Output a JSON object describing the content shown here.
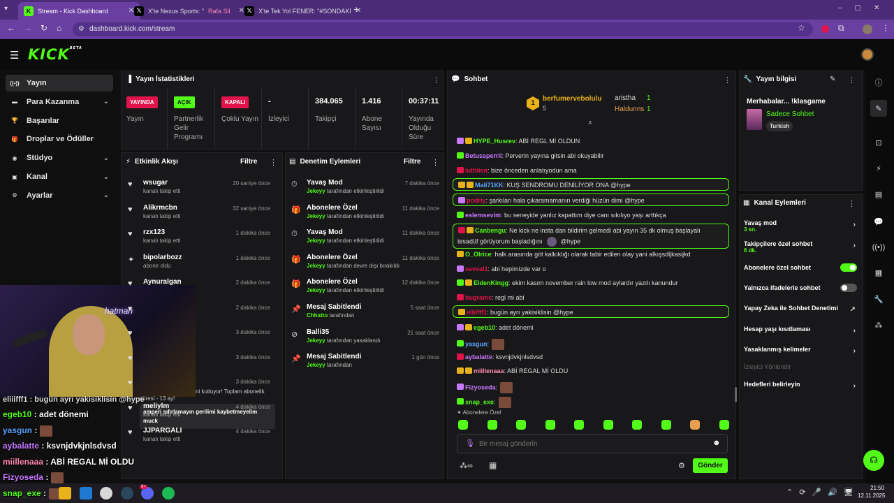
{
  "browser": {
    "tabs": [
      {
        "label": "Stream - Kick Dashboard",
        "icon": "kick-icon"
      },
      {
        "label": "X'te Nexus Sports: \"",
        "extra": "Rafa Sil",
        "icon": "x-icon"
      },
      {
        "label": "X'te Tek Yol FENER: \"#SONDAKİ",
        "icon": "x-icon"
      }
    ],
    "url": "dashboard.kick.com/stream"
  },
  "header": {
    "logo": "KICK",
    "logo_sup": "BETA"
  },
  "sidebar": {
    "items": [
      {
        "label": "Yayın",
        "icon": "broadcast-icon",
        "chevron": false,
        "active": true
      },
      {
        "label": "Para Kazanma",
        "icon": "money-icon",
        "chevron": true
      },
      {
        "label": "Başarılar",
        "icon": "trophy-icon",
        "chevron": false
      },
      {
        "label": "Droplar ve Ödüller",
        "icon": "gift-icon",
        "chevron": false
      },
      {
        "label": "Stüdyo",
        "icon": "studio-icon",
        "chevron": true
      },
      {
        "label": "Kanal",
        "icon": "channel-icon",
        "chevron": true
      },
      {
        "label": "Ayarlar",
        "icon": "gear-icon",
        "chevron": true
      }
    ]
  },
  "stats": {
    "title": "Yayın İstatistikleri",
    "items": [
      {
        "badge": "YAYINDA",
        "badge_color": "#e0134a",
        "label": "Yayın"
      },
      {
        "badge": "AÇIK",
        "badge_color": "#53fc18",
        "label": "Partnerlik Gelir Programı"
      },
      {
        "badge": "KAPALI",
        "badge_color": "#e0134a",
        "label": "Çoklu Yayın"
      },
      {
        "value": "-",
        "label": "İzleyici"
      },
      {
        "value": "384.065",
        "label": "Takipçi"
      },
      {
        "value": "1.416",
        "label": "Abone Sayısı"
      },
      {
        "value": "00:37:11",
        "label": "Yayında Olduğu Süre"
      }
    ]
  },
  "activity": {
    "title": "Etkinlik Akışı",
    "filter": "Filtre",
    "items": [
      {
        "name": "wsugar",
        "sub": "kanalı takip etti",
        "time": "20 saniye önce",
        "icon": "heart-icon"
      },
      {
        "name": "Alikrmcbn",
        "sub": "kanalı takip etti",
        "time": "32 saniye önce",
        "icon": "heart-icon"
      },
      {
        "name": "rzx123",
        "sub": "kanalı takip etti",
        "time": "1 dakika önce",
        "icon": "heart-icon"
      },
      {
        "name": "bipolarbozz",
        "sub": "abone oldu",
        "time": "1 dakika önce",
        "icon": "star-icon"
      },
      {
        "name": "Aynuralgan",
        "sub": "",
        "time": "2 dakika önce",
        "icon": "heart-icon"
      },
      {
        "name": "",
        "sub": "",
        "time": "2 dakika önce",
        "icon": "heart-icon"
      },
      {
        "name": "",
        "sub": "",
        "time": "3 dakika önce",
        "icon": "heart-icon"
      },
      {
        "name": "",
        "sub": "",
        "time": "3 dakika önce",
        "icon": "heart-icon"
      },
      {
        "name": "",
        "sub": "",
        "time": "3 dakika önce",
        "icon": "heart-icon"
      },
      {
        "name": "meliylm",
        "sub": "kanalı takip etti",
        "time": "4 dakika önce",
        "icon": "heart-icon"
      },
      {
        "name": "JJPARGALI",
        "sub": "kanalı takip etti",
        "time": "4 dakika önce",
        "icon": "heart-icon"
      }
    ],
    "sub_note_1": "ni kutluyor! Toplam abonelik",
    "sub_note_2": "süresi - 13 ay!",
    "sub_note_msg": "amperi sıfırlamayın gerilimi kaybetmeyelim muck"
  },
  "moderation": {
    "title": "Denetim Eylemleri",
    "filter": "Filtre",
    "items": [
      {
        "title": "Yavaş Mod",
        "actor": "Jekeyy",
        "action": "tarafından etkinleştirildi",
        "time": "7 dakika önce",
        "icon": "slow-mode-icon"
      },
      {
        "title": "Abonelere Özel",
        "actor": "Jekeyy",
        "action": "tarafından etkinleştirildi",
        "time": "11 dakika önce",
        "icon": "gift-icon"
      },
      {
        "title": "Yavaş Mod",
        "actor": "Jekeyy",
        "action": "tarafından etkinleştirildi",
        "time": "11 dakika önce",
        "icon": "slow-mode-icon"
      },
      {
        "title": "Abonelere Özel",
        "actor": "Jekeyy",
        "action": "tarafından devre dışı bırakıldı",
        "time": "11 dakika önce",
        "icon": "gift-icon"
      },
      {
        "title": "Abonelere Özel",
        "actor": "Jekeyy",
        "action": "tarafından etkinleştirildi",
        "time": "12 dakika önce",
        "icon": "gift-icon"
      },
      {
        "title": "Mesaj Sabitlendi",
        "actor": "Chhatto",
        "action": "tarafından",
        "time": "5 saat önce",
        "icon": "pin-icon"
      },
      {
        "title": "Balli35",
        "actor": "Jekeyy",
        "action": "tarafından yasaklandı",
        "time": "21 saat önce",
        "icon": "ban-icon"
      },
      {
        "title": "Mesaj Sabitlendi",
        "actor": "Jekeyy",
        "action": "tarafından",
        "time": "1 gün önce",
        "icon": "pin-icon"
      }
    ]
  },
  "chat": {
    "title": "Sohbet",
    "top": {
      "rank": "1",
      "name": "berfumervebolulu",
      "count": "5",
      "u2": "aristha",
      "c2": "1",
      "u3": "Haldunns",
      "c3": "1"
    },
    "messages": [
      {
        "user": "HYPE_Husrev",
        "color": "#53fc18",
        "text": ": ABİ REGL Mİ OLDUN",
        "hl": false
      },
      {
        "user": "Betussperrii",
        "color": "#c879ff",
        "text": ": Perverin yayına gitsin abi okuyabilir",
        "hl": false
      },
      {
        "user": "luthiien",
        "color": "#e0134a",
        "text": ": bize önceden anlatıyodun ama",
        "hl": false
      },
      {
        "user": "Mali71KK",
        "color": "#59a3ff",
        "text": ": KUŞ SENDROMU DENİLİYOR ONA @hype",
        "hl": true
      },
      {
        "user": "podriy",
        "color": "#e0134a",
        "text": ": şarkıları hala çıkaramamanın verdiği hüzün dimi @hype",
        "hl": true
      },
      {
        "user": "eslemsevim",
        "color": "#c879ff",
        "text": ": bu seneyide yanlız kapattım diye canı sıkılıyo yaşı arttıkça",
        "hl": false
      },
      {
        "user": "Canbengu",
        "color": "#53fc18",
        "text": ": Ne kick ne insta dan bildirim gelmedi abi yayın 35 dk olmuş başlayalı",
        "text2": "tesadüf görüyorum başladığını",
        "text3": "@hype",
        "hl": true
      },
      {
        "user": "O_Olrice",
        "color": "#53fc18",
        "text": ": halk arasında göt kalkıklığı olarak tabir edilen olay yani alkışsdljkasijkd",
        "hl": false
      },
      {
        "user": "sevval1",
        "color": "#e0134a",
        "text": ": abi hepimizde var o",
        "hl": false
      },
      {
        "user": "EldenKingg",
        "color": "#53fc18",
        "text": ": ekim kasım november rain low mod aylardır yazılı kanundur",
        "hl": false
      },
      {
        "user": "bugrams",
        "color": "#e0134a",
        "text": ": regl mi abi",
        "hl": false
      },
      {
        "user": "eliiifff1",
        "color": "#e0134a",
        "text": ": bugün ayrı yakisiklisin @hype",
        "hl": true
      },
      {
        "user": "egeb10",
        "color": "#53fc18",
        "text": ": adet dönemi",
        "hl": false
      },
      {
        "user": "yasgun",
        "color": "#59a3ff",
        "text": ":",
        "img": true,
        "hl": false
      },
      {
        "user": "aybalatte",
        "color": "#c879ff",
        "text": ": ksvnjdvkjnlsdvsd",
        "hl": false
      },
      {
        "user": "miillenaaa",
        "color": "#ff8ab0",
        "text": ": ABİ REGAL Mİ OLDU",
        "hl": false
      },
      {
        "user": "Fizyoseda",
        "color": "#c879ff",
        "text": ":",
        "img": true,
        "hl": false
      },
      {
        "user": "snap_exe",
        "color": "#53fc18",
        "text": ":",
        "img": true,
        "hl": false
      }
    ],
    "sub_only_label": "Abonelere Özel",
    "placeholder": "Bir mesaj gönderin",
    "send": "Gönder"
  },
  "stream_info": {
    "title": "Yayın bilgisi",
    "stream_title": "Merhabalar... !klasgame",
    "category": "Sadece Sohbet",
    "tag": "Turkish"
  },
  "channel_actions": {
    "title": "Kanal Eylemleri",
    "rows": [
      {
        "label": "Yavaş mod",
        "sub": "3 sn.",
        "kind": "chevron"
      },
      {
        "label": "Takipçilere özel sohbet",
        "sub": "6 dk.",
        "kind": "chevron"
      },
      {
        "label": "Abonelere özel sohbet",
        "sub": "",
        "kind": "toggle",
        "on": true
      },
      {
        "label": "Yalnızca ifadelerle sohbet",
        "sub": "",
        "kind": "toggle",
        "on": false
      },
      {
        "label": "Yapay Zeka ile Sohbet Denetimi",
        "sub": "",
        "kind": "external"
      },
      {
        "label": "Hesap yaşı kısıtlaması",
        "sub": "",
        "kind": "chevron"
      },
      {
        "label": "Yasaklanmış kelimeler",
        "sub": "",
        "kind": "chevron"
      },
      {
        "label": "İzleyici Yönlendir",
        "sub": "",
        "kind": "disabled"
      },
      {
        "label": "Hedefleri belirleyin",
        "sub": "",
        "kind": "chevron"
      }
    ]
  },
  "overlay_chat": [
    {
      "user": "egeb10",
      "color": "#53fc18",
      "text": " : adet dönemi"
    },
    {
      "user": "yasgun",
      "color": "#59a3ff",
      "text": " :",
      "img": true
    },
    {
      "user": "aybalatte",
      "color": "#c879ff",
      "text": " : ksvnjdvkjnlsdvsd"
    },
    {
      "user": "miillenaaa",
      "color": "#ff8ab0",
      "text": " : ABİ REGAL Mİ OLDU"
    },
    {
      "user": "Fizyoseda",
      "color": "#c879ff",
      "text": " :",
      "img": true
    },
    {
      "user": "snap_exe",
      "color": "#53fc18",
      "text": " :",
      "img": true
    }
  ],
  "overlay_top": "eliiifff1 : bugün ayrı yakisiklisin @hype",
  "taskbar": {
    "time": "21:50",
    "date": "12.11.2025",
    "badge": "9+"
  }
}
